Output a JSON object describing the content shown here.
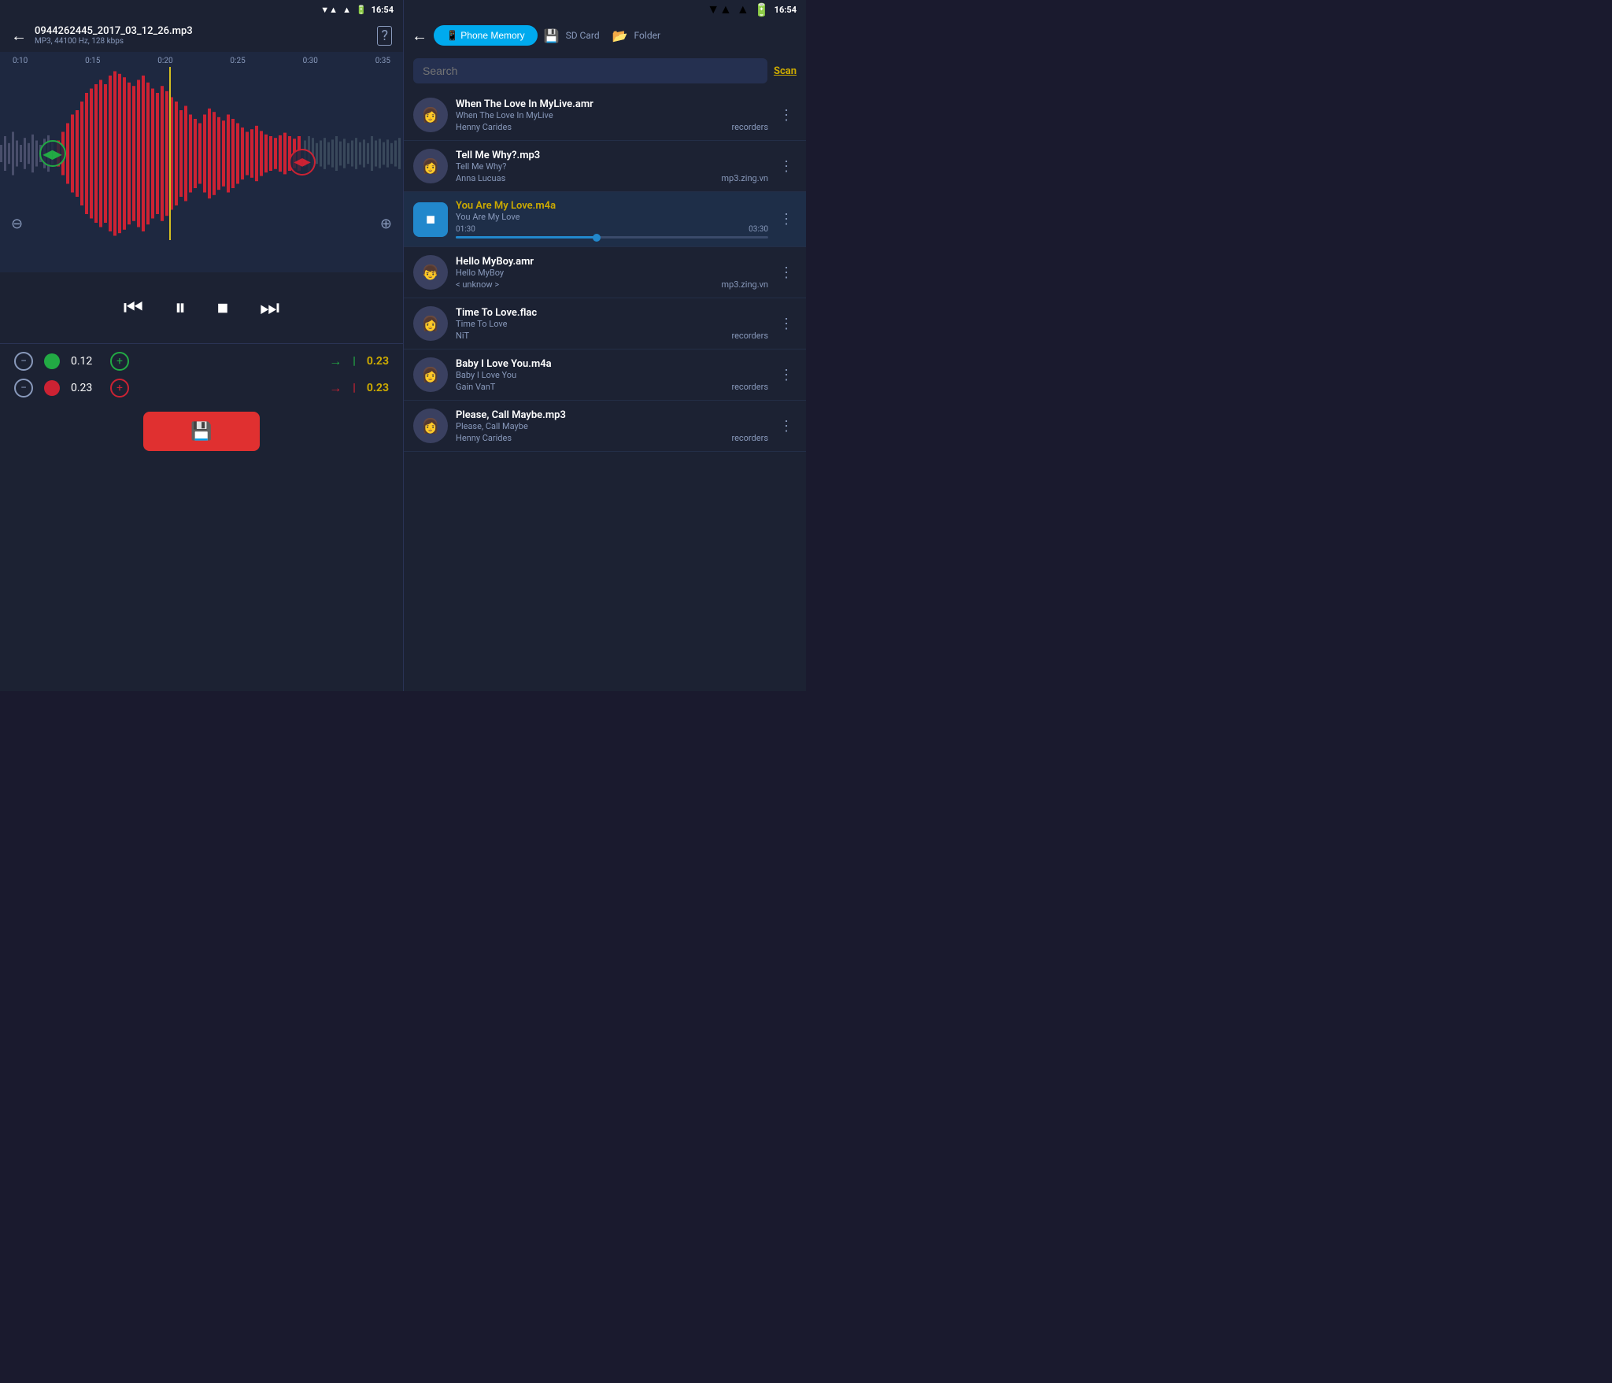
{
  "app": {
    "time": "16:54"
  },
  "left": {
    "back_label": "←",
    "filename": "0944262445_2017_03_12_26.mp3",
    "meta": "MP3, 44100 Hz, 128 kbps",
    "help_icon": "?",
    "timeline_marks": [
      "0:10",
      "0:15",
      "0:20",
      "0:25",
      "0:30",
      "0:35"
    ],
    "zoom_out_icon": "⊖",
    "zoom_in_icon": "⊕",
    "controls": {
      "rewind": "⏮",
      "pause": "⏸",
      "stop": "⏹",
      "forward": "⏭"
    },
    "edit_rows": [
      {
        "minus_icon": "−",
        "dot_color": "green",
        "value": "0.12",
        "plus_icon": "+",
        "arrow": "→",
        "bar": "|",
        "duration": "0.23",
        "arrow_color": "green"
      },
      {
        "minus_icon": "−",
        "dot_color": "red",
        "value": "0.23",
        "plus_icon": "+",
        "arrow": "→",
        "bar": "|",
        "duration": "0.23",
        "arrow_color": "red"
      }
    ],
    "save_icon": "💾"
  },
  "right": {
    "back_label": "←",
    "tabs": [
      {
        "label": "Phone Memory",
        "active": true,
        "icon": "📱"
      },
      {
        "label": "SD Card",
        "active": false,
        "icon": "💾"
      },
      {
        "label": "Folder",
        "active": false,
        "icon": "📂"
      }
    ],
    "search": {
      "placeholder": "Search",
      "scan_label": "Scan"
    },
    "songs": [
      {
        "title": "When The Love In MyLive.amr",
        "subtitle": "When The Love In MyLive",
        "artist": "Henny Carides",
        "source": "recorders",
        "active": false,
        "avatar_emoji": "👩"
      },
      {
        "title": "Tell Me Why?.mp3",
        "subtitle": "Tell Me Why?",
        "artist": "Anna Lucuas",
        "source": "mp3.zing.vn",
        "active": false,
        "avatar_emoji": "👩"
      },
      {
        "title": "You Are My Love.m4a",
        "subtitle": "You Are My Love",
        "artist": "",
        "source": "",
        "active": true,
        "progress_start": "01:30",
        "progress_end": "03:30",
        "progress_pct": 45,
        "avatar_emoji": "■"
      },
      {
        "title": "Hello MyBoy.amr",
        "subtitle": "Hello MyBoy",
        "artist": "< unknow >",
        "source": "mp3.zing.vn",
        "active": false,
        "avatar_emoji": "👦"
      },
      {
        "title": "Time To Love.flac",
        "subtitle": "Time To Love",
        "artist": "NiT",
        "source": "recorders",
        "active": false,
        "avatar_emoji": "👩"
      },
      {
        "title": "Baby I Love You.m4a",
        "subtitle": "Baby I Love You",
        "artist": "Gain VanT",
        "source": "recorders",
        "active": false,
        "avatar_emoji": "👩"
      },
      {
        "title": "Please, Call Maybe.mp3",
        "subtitle": "Please, Call Maybe",
        "artist": "Henny Carides",
        "source": "recorders",
        "active": false,
        "avatar_emoji": "👩"
      }
    ]
  }
}
